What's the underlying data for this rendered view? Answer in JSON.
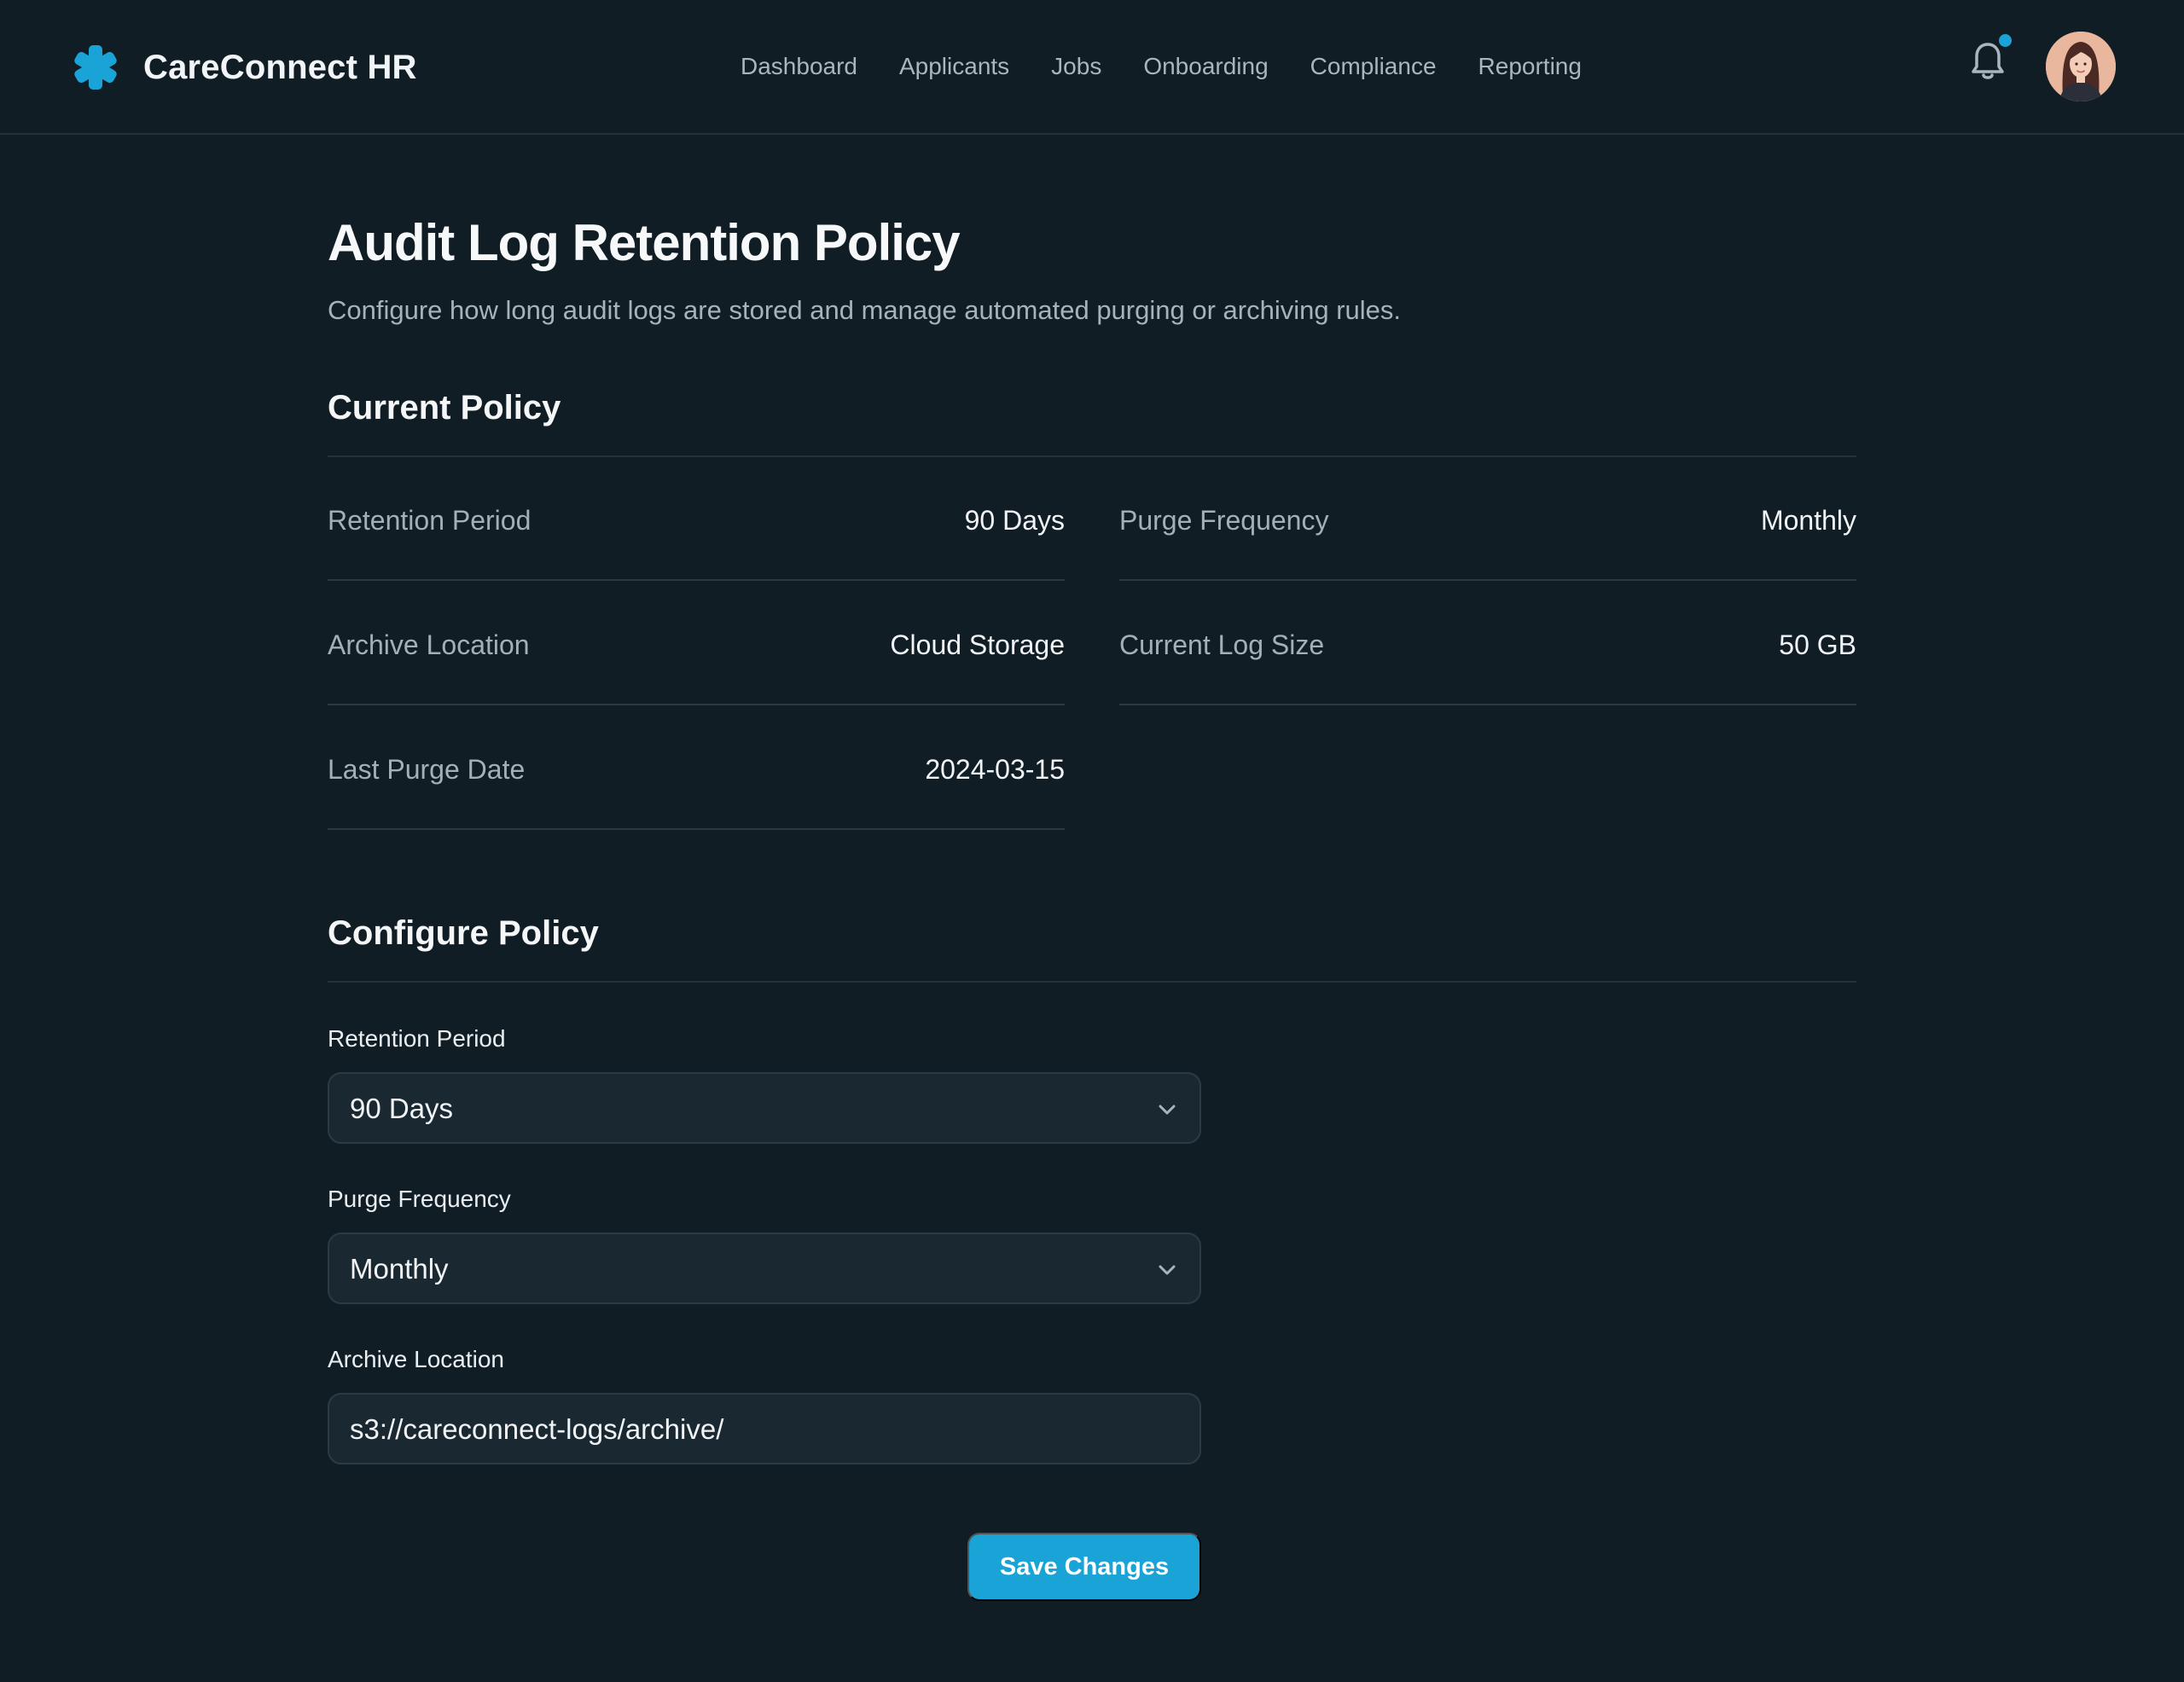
{
  "app": {
    "name": "CareConnect HR",
    "logo_icon": "medical-asterisk-icon",
    "accent_color": "#1aa3d6",
    "background_color": "#111d24"
  },
  "nav": {
    "items": [
      {
        "label": "Dashboard"
      },
      {
        "label": "Applicants"
      },
      {
        "label": "Jobs"
      },
      {
        "label": "Onboarding"
      },
      {
        "label": "Compliance"
      },
      {
        "label": "Reporting"
      }
    ]
  },
  "header_actions": {
    "notification_icon": "bell-icon",
    "has_unread_notifications": true,
    "avatar_icon": "user-avatar"
  },
  "page": {
    "title": "Audit Log Retention Policy",
    "subtitle": "Configure how long audit logs are stored and manage automated purging or archiving rules."
  },
  "current_policy": {
    "title": "Current Policy",
    "items": [
      {
        "label": "Retention Period",
        "value": "90 Days"
      },
      {
        "label": "Purge Frequency",
        "value": "Monthly"
      },
      {
        "label": "Archive Location",
        "value": "Cloud Storage"
      },
      {
        "label": "Current Log Size",
        "value": "50 GB"
      },
      {
        "label": "Last Purge Date",
        "value": "2024-03-15"
      }
    ]
  },
  "configure_policy": {
    "title": "Configure Policy",
    "retention_period": {
      "label": "Retention Period",
      "value": "90 Days",
      "icon": "chevron-down-icon"
    },
    "purge_frequency": {
      "label": "Purge Frequency",
      "value": "Monthly",
      "icon": "chevron-down-icon"
    },
    "archive_location": {
      "label": "Archive Location",
      "value": "s3://careconnect-logs/archive/"
    },
    "save_label": "Save Changes"
  }
}
